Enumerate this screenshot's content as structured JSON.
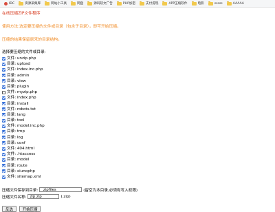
{
  "bookmarks": [
    "IDC",
    "资源采集库",
    "网站小工具",
    "网盘",
    "源码软文广告",
    "PHP加密",
    "支付提现",
    "APP压缩软件",
    "电影",
    "sssss",
    "AAAAA"
  ],
  "page": {
    "title": "在线压缩ZIP文件程序",
    "note1": "使用方法:选定要压缩的文件或目录（包含子目录），即可开始压缩。",
    "note2": "压缩的结果保留原来的目录结构。",
    "select_label": "选择要压缩的文件或目录:"
  },
  "files": [
    {
      "label": "文件: unzip.php",
      "checked": true
    },
    {
      "label": "目录: upload",
      "checked": true
    },
    {
      "label": "文件: index.inc.php",
      "checked": true
    },
    {
      "label": "目录: admin",
      "checked": true
    },
    {
      "label": "目录: view",
      "checked": true
    },
    {
      "label": "目录: plugin",
      "checked": true
    },
    {
      "label": "文件: myzip.php",
      "checked": false
    },
    {
      "label": "文件: index.php",
      "checked": true
    },
    {
      "label": "目录: install",
      "checked": true
    },
    {
      "label": "文件: robots.txt",
      "checked": true
    },
    {
      "label": "目录: lang",
      "checked": true
    },
    {
      "label": "目录: tool",
      "checked": true
    },
    {
      "label": "文件: model.inc.php",
      "checked": true
    },
    {
      "label": "目录: tmp",
      "checked": true
    },
    {
      "label": "目录: log",
      "checked": true
    },
    {
      "label": "目录: conf",
      "checked": true
    },
    {
      "label": "文件: 404.html",
      "checked": true
    },
    {
      "label": "文件: .htaccess",
      "checked": true
    },
    {
      "label": "目录: model",
      "checked": true
    },
    {
      "label": "目录: route",
      "checked": true
    },
    {
      "label": "目录: xiunophp",
      "checked": true
    },
    {
      "label": "文件: sitemap.xml",
      "checked": true
    }
  ],
  "form": {
    "save_dir_label": "压缩文件保存到目录:",
    "save_dir_value": "_zipfiles_",
    "save_dir_hint": "(留空为本目录,必须有写入权限)",
    "zip_name_label": "压缩文件名称:",
    "zip_name_value": "zip.zip",
    "zip_name_hint": "(.zip)"
  },
  "buttons": {
    "invert": "反选",
    "start": "开始压缩"
  },
  "colors": {
    "title": "#d63b1f",
    "note": "#f08a24",
    "checkbox": "#3a73d9"
  }
}
